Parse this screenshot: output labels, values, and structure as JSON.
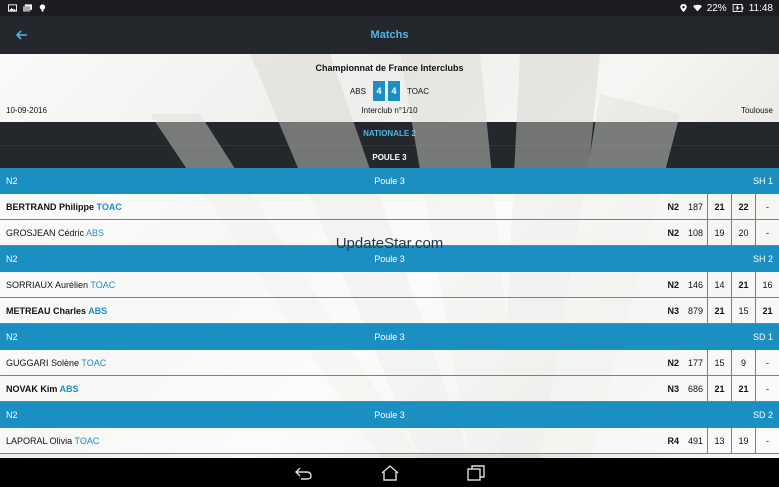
{
  "status_bar": {
    "battery": "22%",
    "time": "11:48"
  },
  "app_bar": {
    "title": "Matchs"
  },
  "header": {
    "championship": "Championnat de France Interclubs",
    "team_home": "ABS",
    "score_home": "4",
    "score_away": "4",
    "team_away": "TOAC",
    "date": "10-09-2016",
    "interclub": "Interclub n°1/10",
    "city": "Toulouse"
  },
  "division": "NATIONALE 2",
  "pool": "POULE 3",
  "watermark": "UpdateStar.com",
  "matches": [
    {
      "category": "N2",
      "pool": "Poule 3",
      "code": "SH 1",
      "players": [
        {
          "name": "BERTRAND Philippe",
          "club": "TOAC",
          "level": "N2",
          "rank": "187",
          "sets": [
            "21",
            "22",
            "-"
          ],
          "bold": [
            true,
            true,
            false
          ],
          "win": true
        },
        {
          "name": "GROSJEAN Cédric",
          "club": "ABS",
          "level": "N2",
          "rank": "108",
          "sets": [
            "19",
            "20",
            "-"
          ],
          "bold": [
            false,
            false,
            false
          ],
          "win": false
        }
      ]
    },
    {
      "category": "N2",
      "pool": "Poule 3",
      "code": "SH 2",
      "players": [
        {
          "name": "SORRIAUX Aurélien",
          "club": "TOAC",
          "level": "N2",
          "rank": "146",
          "sets": [
            "14",
            "21",
            "16"
          ],
          "bold": [
            false,
            true,
            false
          ],
          "win": false
        },
        {
          "name": "METREAU Charles",
          "club": "ABS",
          "level": "N3",
          "rank": "879",
          "sets": [
            "21",
            "15",
            "21"
          ],
          "bold": [
            true,
            false,
            true
          ],
          "win": true
        }
      ]
    },
    {
      "category": "N2",
      "pool": "Poule 3",
      "code": "SD 1",
      "players": [
        {
          "name": "GUGGARI Solène",
          "club": "TOAC",
          "level": "N2",
          "rank": "177",
          "sets": [
            "15",
            "9",
            "-"
          ],
          "bold": [
            false,
            false,
            false
          ],
          "win": false
        },
        {
          "name": "NOVAK Kim",
          "club": "ABS",
          "level": "N3",
          "rank": "686",
          "sets": [
            "21",
            "21",
            "-"
          ],
          "bold": [
            true,
            true,
            false
          ],
          "win": true
        }
      ]
    },
    {
      "category": "N2",
      "pool": "Poule 3",
      "code": "SD 2",
      "players": [
        {
          "name": "LAPORAL Olivia",
          "club": "TOAC",
          "level": "R4",
          "rank": "491",
          "sets": [
            "13",
            "19",
            "-"
          ],
          "bold": [
            false,
            false,
            false
          ],
          "win": false
        }
      ]
    }
  ]
}
